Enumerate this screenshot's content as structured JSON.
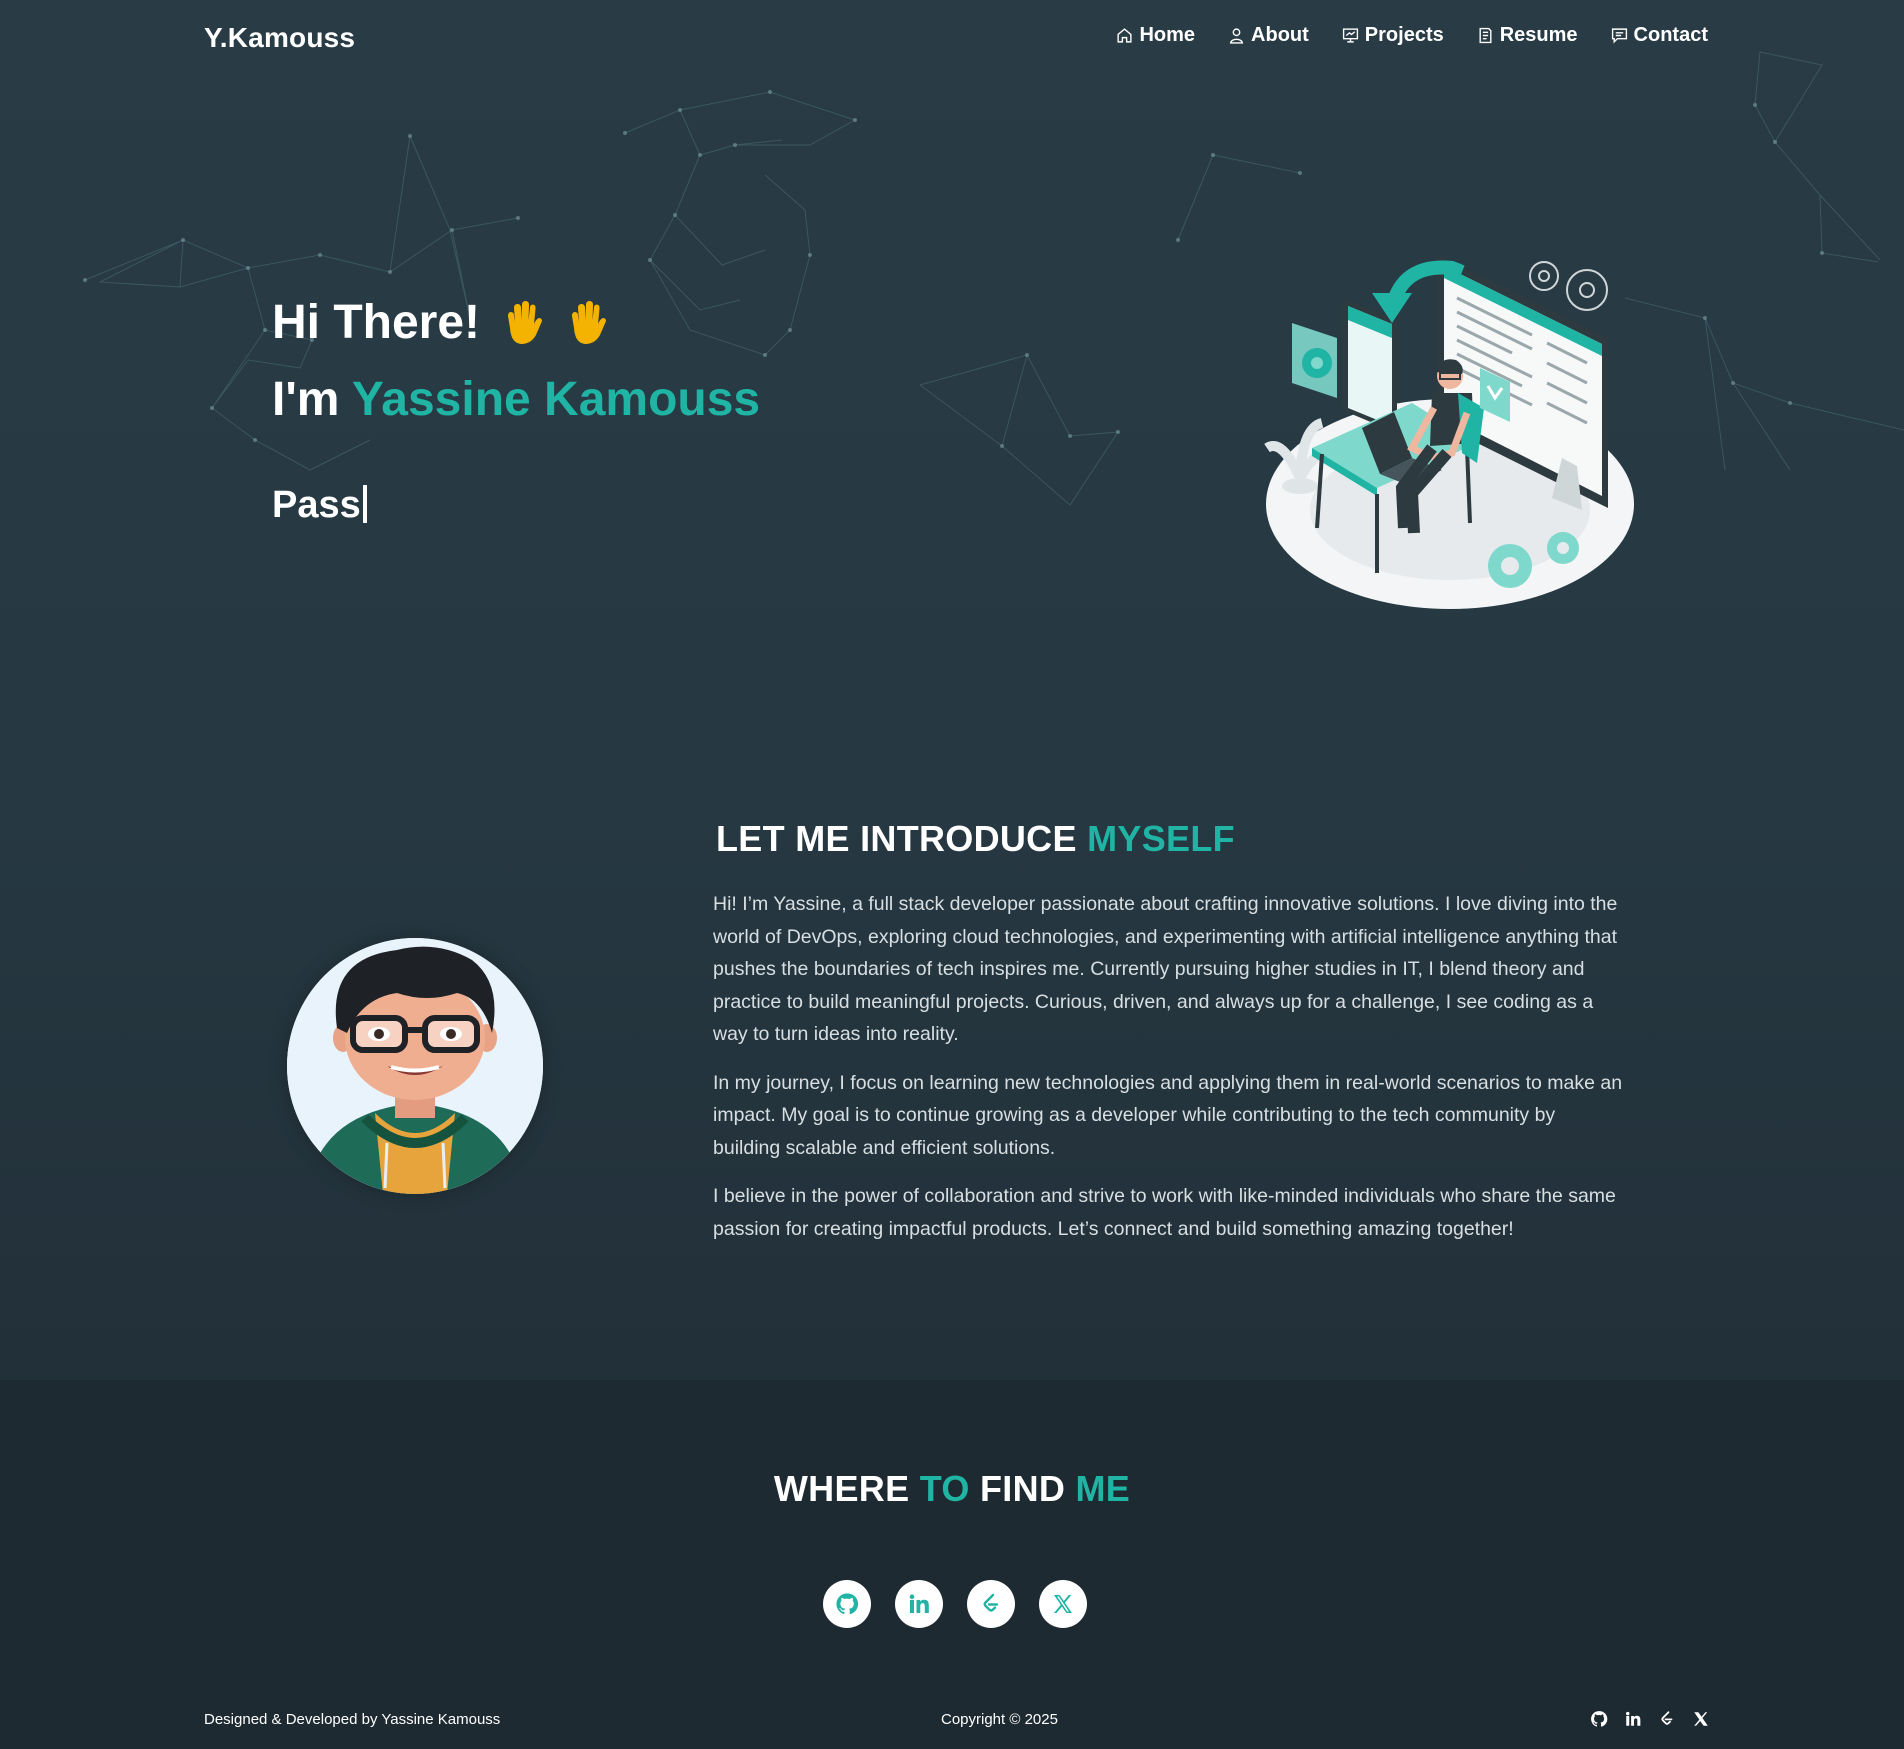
{
  "nav": {
    "brand": "Y.Kamouss",
    "links": [
      {
        "label": "Home",
        "icon": "home-icon"
      },
      {
        "label": "About",
        "icon": "user-icon"
      },
      {
        "label": "Projects",
        "icon": "presentation-icon"
      },
      {
        "label": "Resume",
        "icon": "document-icon"
      },
      {
        "label": "Contact",
        "icon": "chat-icon"
      }
    ]
  },
  "hero": {
    "greeting": "Hi There!",
    "intro_prefix": "I'm ",
    "name": "Yassine Kamouss",
    "typed_text": "Pass"
  },
  "about": {
    "title_main": "LET ME INTRODUCE ",
    "title_accent": "MYSELF",
    "paragraphs": [
      "Hi! I’m Yassine, a full stack developer passionate about crafting innovative solutions. I love diving into the world of DevOps, exploring cloud technologies, and experimenting with artificial intelligence anything that pushes the boundaries of tech inspires me. Currently pursuing higher studies in IT, I blend theory and practice to build meaningful projects. Curious, driven, and always up for a challenge, I see coding as a way to turn ideas into reality.",
      "In my journey, I focus on learning new technologies and applying them in real-world scenarios to make an impact. My goal is to continue growing as a developer while contributing to the tech community by building scalable and efficient solutions.",
      "I believe in the power of collaboration and strive to work with like-minded individuals who share the same passion for creating impactful products. Let’s connect and build something amazing together!"
    ]
  },
  "find": {
    "w1": "WHERE ",
    "w2": "TO",
    "w3": " FIND ",
    "w4": "ME",
    "socials": [
      "github-icon",
      "linkedin-icon",
      "leetcode-icon",
      "x-icon"
    ]
  },
  "footer": {
    "credit": "Designed & Developed by Yassine Kamouss",
    "copyright": "Copyright © 2025"
  },
  "colors": {
    "accent": "#1fb4a3",
    "background": "#263842",
    "footer_bg": "#1e2a31"
  }
}
